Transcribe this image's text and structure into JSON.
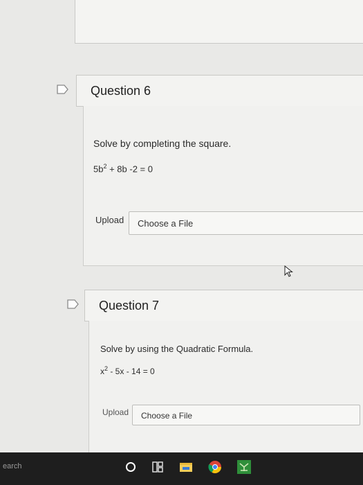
{
  "questions": [
    {
      "title": "Question 6",
      "prompt": "Solve by completing the square.",
      "equation": {
        "a": "5b",
        "exp": "2",
        "rest": " + 8b -2 = 0"
      },
      "upload_label": "Upload",
      "choose_label": "Choose a File"
    },
    {
      "title": "Question 7",
      "prompt": "Solve by using the Quadratic Formula.",
      "equation": {
        "a": "x",
        "exp": "2",
        "rest": " - 5x - 14 = 0"
      },
      "upload_label": "Upload",
      "choose_label": "Choose a File"
    }
  ],
  "taskbar": {
    "search_label": "earch",
    "icons": [
      "cortana-icon",
      "task-view-icon",
      "file-explorer-icon",
      "chrome-icon",
      "app-icon"
    ]
  },
  "colors": {
    "taskbar": "#1e1e1e",
    "page_bg": "#e9e9e7"
  }
}
